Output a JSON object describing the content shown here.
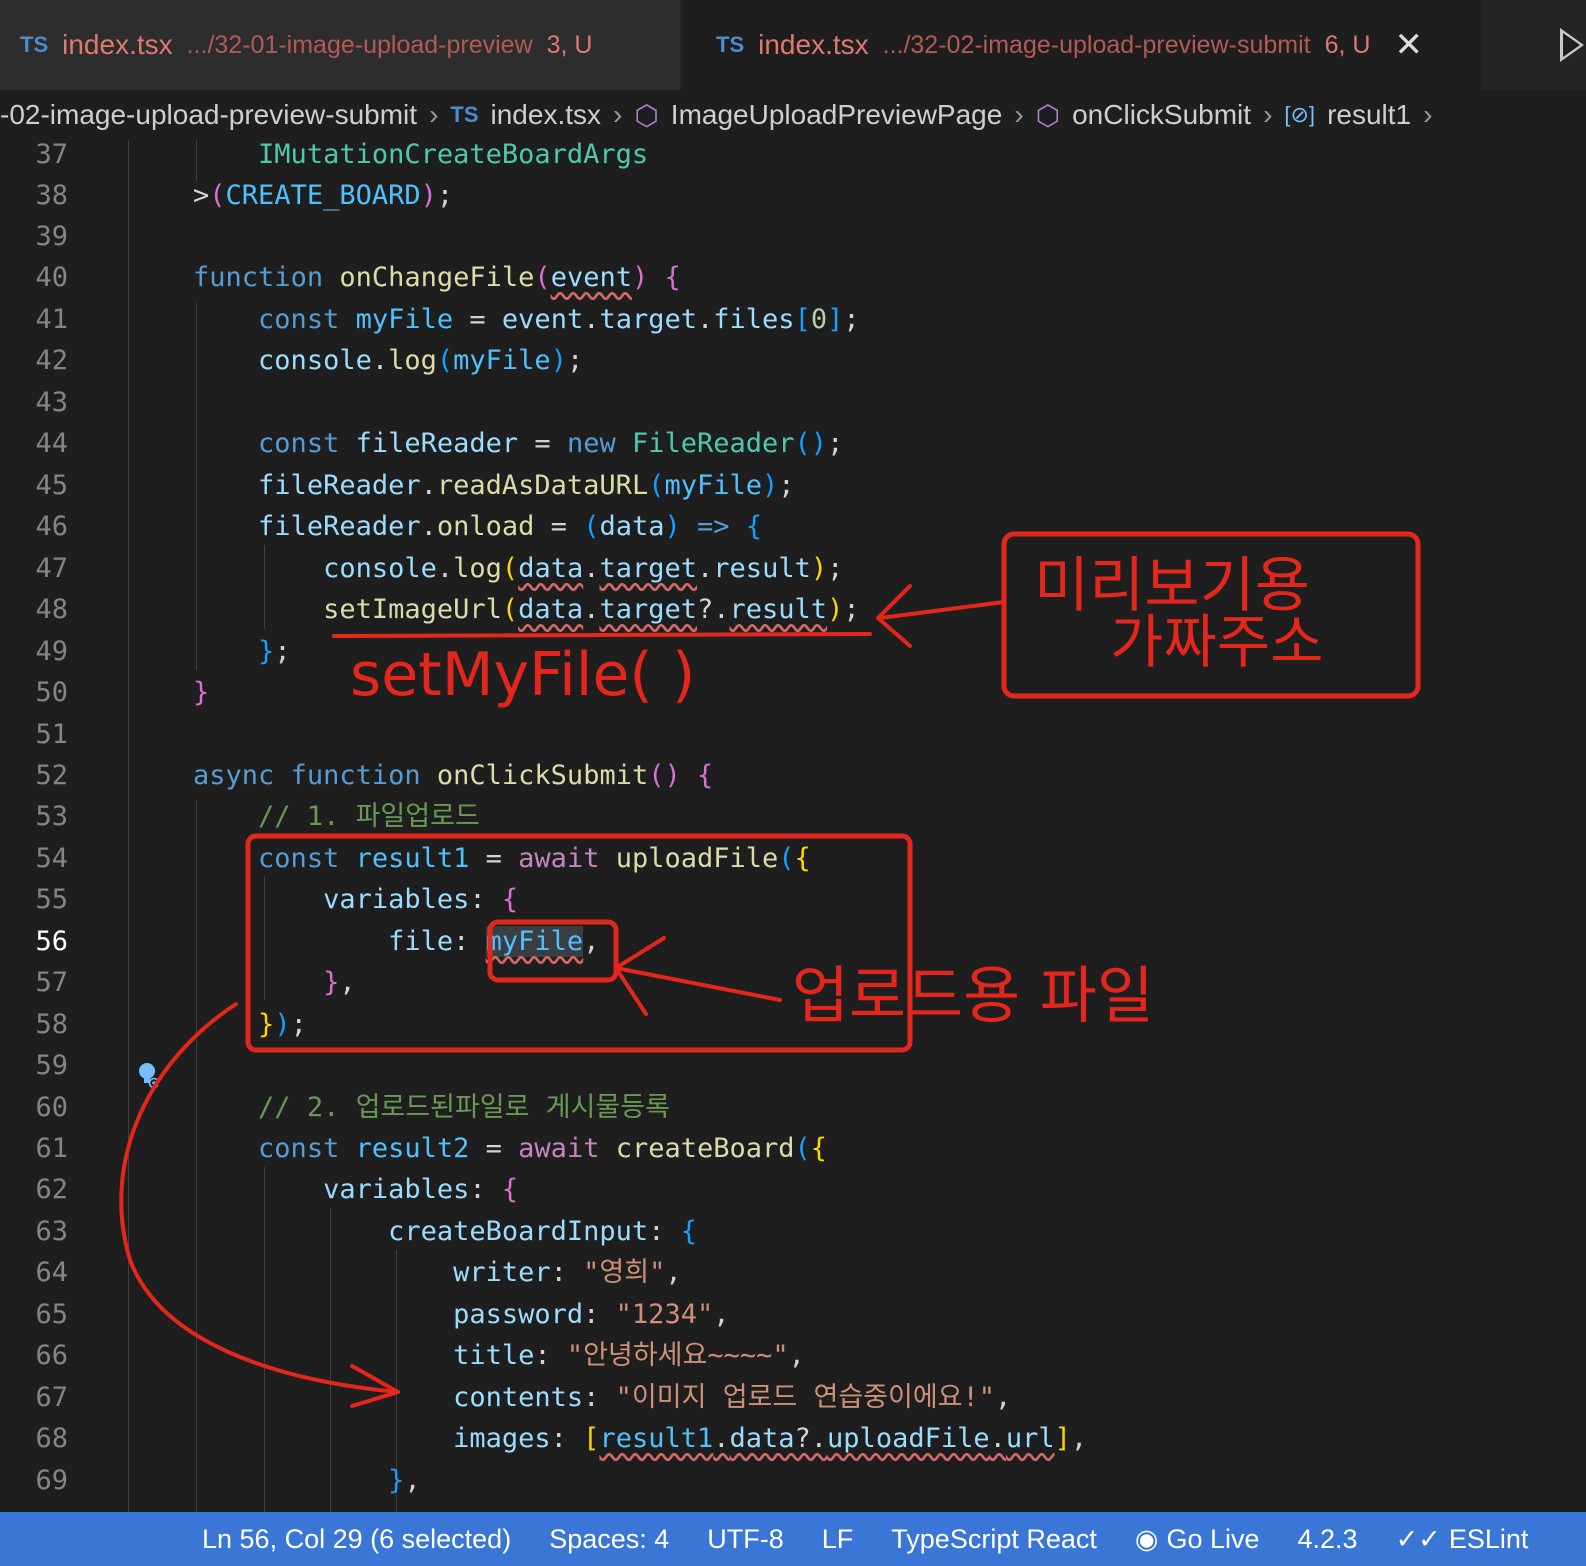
{
  "tabs": [
    {
      "lang": "TS",
      "name": "index.tsx",
      "path": ".../32-01-image-upload-preview",
      "status": "3, U",
      "active": false
    },
    {
      "lang": "TS",
      "name": "index.tsx",
      "path": ".../32-02-image-upload-preview-submit",
      "status": "6, U",
      "active": true
    }
  ],
  "breadcrumb": [
    "-02-image-upload-preview-submit",
    "index.tsx",
    "ImageUploadPreviewPage",
    "onClickSubmit",
    "result1"
  ],
  "editor": {
    "line_numbers": [
      "37",
      "38",
      "39",
      "40",
      "41",
      "42",
      "43",
      "44",
      "45",
      "46",
      "47",
      "48",
      "49",
      "50",
      "51",
      "52",
      "53",
      "54",
      "55",
      "56",
      "57",
      "58",
      "59",
      "60",
      "61",
      "62",
      "63",
      "64",
      "65",
      "66",
      "67",
      "68",
      "69"
    ],
    "current_line": "56"
  },
  "annotations": {
    "preview_note_line1": "미리보기용",
    "preview_note_line2": "가짜주소",
    "set_file_note": "setMyFile( )",
    "upload_file_note": "업로드용 파일",
    "color": "#e3271c"
  },
  "statusbar": {
    "position": "Ln 56, Col 29 (6 selected)",
    "spaces": "Spaces: 4",
    "encoding": "UTF-8",
    "eol": "LF",
    "language": "TypeScript React",
    "go_live": "Go Live",
    "version": "4.2.3",
    "eslint": "ESLint"
  },
  "colors": {
    "status_bar": "#3a76d6",
    "editor_bg": "#1e1e1e",
    "annotation": "#e3271c"
  }
}
